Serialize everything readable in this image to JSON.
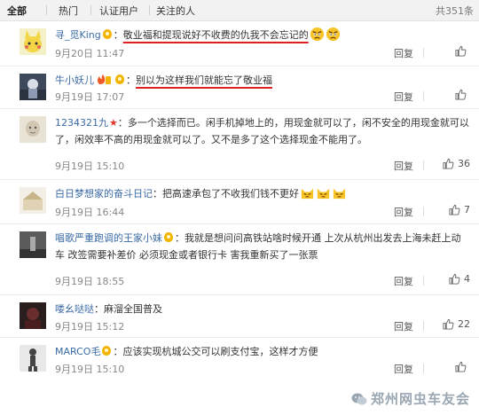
{
  "tabs": [
    {
      "label": "全部",
      "active": true
    },
    {
      "label": "热门",
      "active": false
    },
    {
      "label": "认证用户",
      "active": false
    },
    {
      "label": "关注的人",
      "active": false
    }
  ],
  "total": "共351条",
  "reply_label": "回复",
  "comments": [
    {
      "user": "寻_觅King",
      "sep": "：",
      "text": "敬业福和提现说好不收费的仇我不会忘记的",
      "time": "9月20日 11:47",
      "likes": ""
    },
    {
      "user": "牛小妖儿",
      "sep": "：",
      "text": "别以为这样我们就能忘了敬业福",
      "time": "9月19日 17:07",
      "likes": ""
    },
    {
      "user": "1234321九",
      "sep": "：",
      "text": "多一个选择而已。闲手机掉地上的，用现金就可以了，闲不安全的用现金就可以了，闲效率不高的用现金就可以了。又不是多了这个选择现金不能用了。",
      "time": "9月19日 15:10",
      "likes": "36"
    },
    {
      "user": "白日梦想家的奋斗日记",
      "sep": "：",
      "text": "把高速承包了不收我们钱不更好",
      "time": "9月19日 16:44",
      "likes": "7"
    },
    {
      "user": "唱歌严重跑调的王家小妹",
      "sep": "：",
      "text": "我就是想问问高铁站啥时候开通 上次从杭州出发去上海未赶上动车 改签需要补差价 必须现金或者银行卡 害我重新买了一张票",
      "time": "9月19日 18:55",
      "likes": "4"
    },
    {
      "user": "喽幺哒哒",
      "sep": "：",
      "text": "麻溜全国普及",
      "time": "9月19日 15:12",
      "likes": "22"
    },
    {
      "user": "MARCO毛",
      "sep": "：",
      "text": "应该实现杭城公交可以刷支付宝，这样才方便",
      "time": "9月19日 15:10",
      "likes": ""
    }
  ],
  "watermark": "郑州网虫车友会",
  "colors": {
    "username": "#e58a00",
    "link_blue": "#3a6aa5",
    "underline": "#e02020",
    "vip": "#f2b400"
  }
}
